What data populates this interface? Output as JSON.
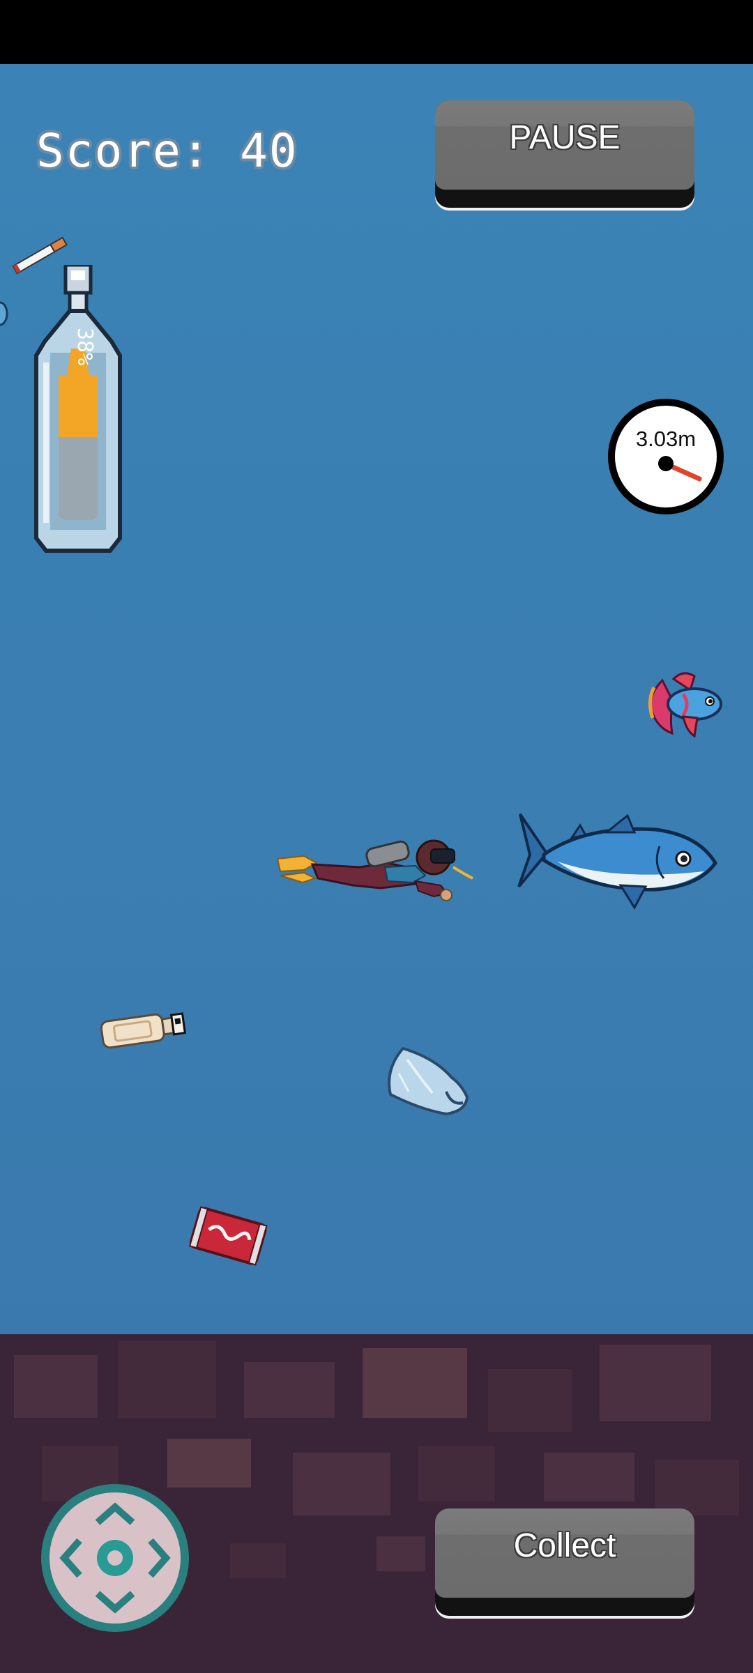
{
  "hud": {
    "score_text": "Score: 40",
    "pause_label": "PAUSE",
    "collect_label": "Collect",
    "oxygen_text": "38%",
    "oxygen_level": 0.38,
    "depth_text": "3.03m"
  },
  "colors": {
    "sea": "#3b7eb1",
    "seafloor": "#3a2538",
    "oxygen_fill": "#f3a526",
    "button_face": "#6e6e6e",
    "dpad_ring": "#2a7f7f",
    "dpad_body": "#d9c2c7",
    "needle": "#e0452c"
  },
  "icons": {
    "dpad": "directional-pad-icon",
    "oxygen": "oxygen-bottle-icon",
    "depth": "depth-gauge-icon"
  }
}
